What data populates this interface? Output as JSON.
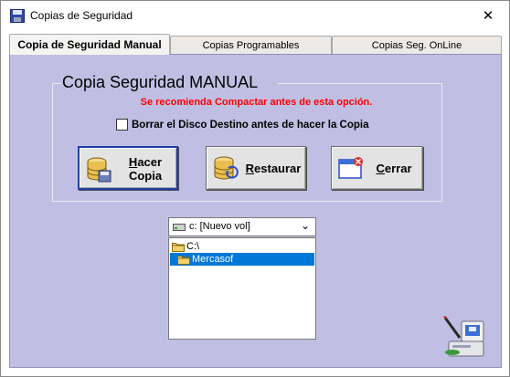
{
  "window": {
    "title": "Copias de Seguridad",
    "close_label": "✕"
  },
  "tabs": [
    {
      "label": "Copia de Seguridad Manual",
      "active": true
    },
    {
      "label": "Copias Programables",
      "active": false
    },
    {
      "label": "Copias Seg. OnLine",
      "active": false
    }
  ],
  "manual": {
    "group_title": "Copia Seguridad MANUAL",
    "warning": "Se recomienda Compactar antes de esta opción.",
    "checkbox_label": "Borrar el Disco Destino antes de hacer la Copia",
    "checkbox_checked": false,
    "buttons": {
      "backup_line1_hotkey": "H",
      "backup_line1_rest": "acer",
      "backup_line2": "Copia",
      "restore_hotkey": "R",
      "restore_rest": "estaurar",
      "close_hotkey": "C",
      "close_rest": "errar"
    }
  },
  "drive": {
    "selected": "c: [Nuevo vol]"
  },
  "directories": [
    {
      "name": "C:\\",
      "selected": false
    },
    {
      "name": "Mercasof",
      "selected": true
    }
  ],
  "colors": {
    "panel": "#c0bfe3",
    "warning": "#ff0000",
    "selection": "#0078d7"
  }
}
